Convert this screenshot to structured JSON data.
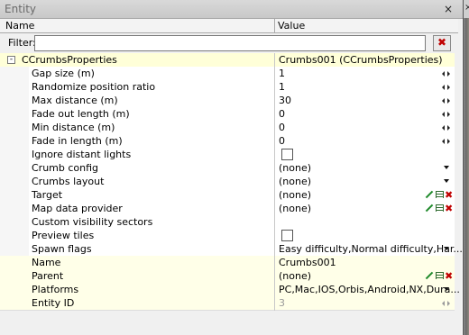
{
  "window": {
    "title": "Entity",
    "close_glyph": "×",
    "side_glyph": "×"
  },
  "columns": {
    "name": "Name",
    "value": "Value"
  },
  "filter": {
    "label": "Filter:",
    "value": "",
    "placeholder": "",
    "clear_icon": "clear-x-icon"
  },
  "group": {
    "expander": "-",
    "name": "CCrumbsProperties",
    "value": "Crumbs001 (CCrumbsProperties)"
  },
  "rows": [
    {
      "name": "Gap size (m)",
      "value": "1",
      "control": "spinner"
    },
    {
      "name": "Randomize position ratio",
      "value": "1",
      "control": "spinner"
    },
    {
      "name": "Max distance (m)",
      "value": "30",
      "control": "spinner"
    },
    {
      "name": "Fade out length (m)",
      "value": "0",
      "control": "spinner"
    },
    {
      "name": "Min distance (m)",
      "value": "0",
      "control": "spinner"
    },
    {
      "name": "Fade in length (m)",
      "value": "0",
      "control": "spinner"
    },
    {
      "name": "Ignore distant lights",
      "value": "",
      "control": "checkbox",
      "checked": false
    },
    {
      "name": "Crumb config",
      "value": "(none)",
      "control": "dropdown"
    },
    {
      "name": "Crumbs layout",
      "value": "(none)",
      "control": "dropdown"
    },
    {
      "name": "Target",
      "value": "(none)",
      "control": "picker"
    },
    {
      "name": "Map data provider",
      "value": "(none)",
      "control": "picker"
    },
    {
      "name": "Custom visibility sectors",
      "value": "",
      "control": "none"
    },
    {
      "name": "Preview tiles",
      "value": "",
      "control": "checkbox",
      "checked": false
    },
    {
      "name": "Spawn flags",
      "value": "Easy difficulty,Normal difficulty,Har...",
      "control": "dropdown"
    }
  ],
  "entity_rows": [
    {
      "name": "Name",
      "value": "Crumbs001",
      "control": "none"
    },
    {
      "name": "Parent",
      "value": "(none)",
      "control": "picker"
    },
    {
      "name": "Platforms",
      "value": "PC,Mac,IOS,Orbis,Android,NX,Dura...",
      "control": "dropdown"
    },
    {
      "name": "Entity ID",
      "value": "3",
      "control": "spinner-disabled"
    }
  ],
  "colors": {
    "group_bg": "#ffffd8",
    "alt_bg": "#ffffe8",
    "clear_red": "#c00000",
    "pick_green": "#1e8a2a"
  }
}
